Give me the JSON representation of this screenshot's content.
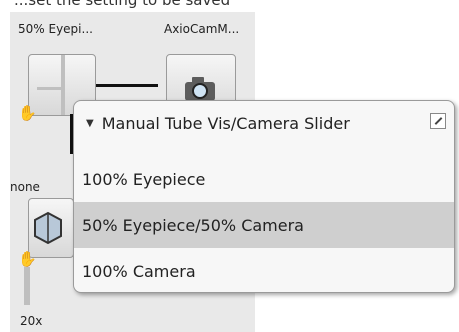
{
  "top_caption": "...set the setting to be saved",
  "lightpath": {
    "eyepiece_label": "50% Eyepi...",
    "camera_label": "AxioCamM...",
    "none_label": "none",
    "objective_label": "20x"
  },
  "popup": {
    "title": "Manual Tube Vis/Camera Slider",
    "items": [
      {
        "label": "100% Eyepiece",
        "selected": false
      },
      {
        "label": "50% Eyepiece/50% Camera",
        "selected": true
      },
      {
        "label": "100% Camera",
        "selected": false
      }
    ]
  }
}
